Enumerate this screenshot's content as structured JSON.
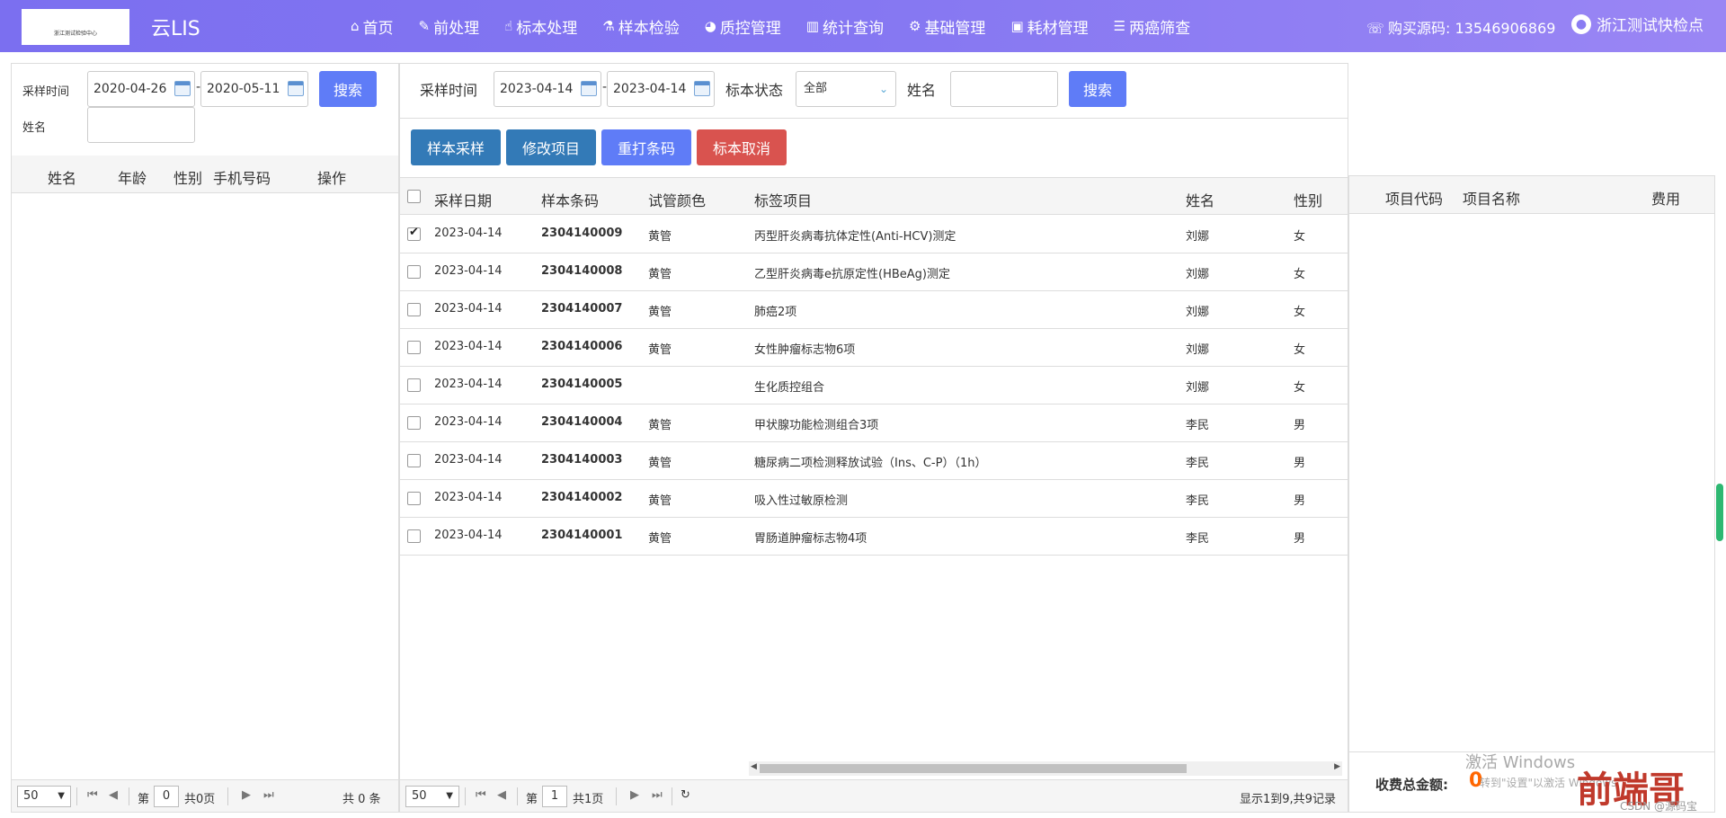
{
  "app": {
    "logo_text": "浙江测试检验中心",
    "brand": "云LIS"
  },
  "nav": [
    {
      "label": "首页",
      "icon": "home-icon",
      "glyph": "⌂"
    },
    {
      "label": "前处理",
      "icon": "wrench-icon",
      "glyph": "✎"
    },
    {
      "label": "标本处理",
      "icon": "hand-icon",
      "glyph": "☝"
    },
    {
      "label": "样本检验",
      "icon": "flask-icon",
      "glyph": "⚗"
    },
    {
      "label": "质控管理",
      "icon": "pie-chart-icon",
      "glyph": "◕"
    },
    {
      "label": "统计查询",
      "icon": "bar-chart-icon",
      "glyph": "▥"
    },
    {
      "label": "基础管理",
      "icon": "gear-icon",
      "glyph": "⚙"
    },
    {
      "label": "耗材管理",
      "icon": "briefcase-icon",
      "glyph": "▣"
    },
    {
      "label": "两癌筛查",
      "icon": "list-icon",
      "glyph": "☰"
    }
  ],
  "header_right": {
    "buy_label": "购买源码: 13546906869",
    "user_name": "浙江测试快检点"
  },
  "left_panel": {
    "sample_time_label": "采样时间",
    "date_from": "2020-04-26",
    "date_to": "2020-05-11",
    "dash": "-",
    "search_button": "搜索",
    "name_label": "姓名",
    "name_value": "",
    "columns": [
      "姓名",
      "年龄",
      "性别",
      "手机号码",
      "操作"
    ],
    "pager": {
      "page_size": "50",
      "page_prefix": "第",
      "page_value": "0",
      "total_pages": "共0页",
      "total_records": "共 0 条"
    }
  },
  "mid_panel": {
    "filters": {
      "sample_time_label": "采样时间",
      "date_from": "2023-04-14",
      "date_to": "2023-04-14",
      "dash": "-",
      "status_label": "标本状态",
      "status_value": "全部",
      "name_label": "姓名",
      "name_value": "",
      "search_button": "搜索"
    },
    "actions": {
      "collect": "样本采样",
      "modify": "修改项目",
      "reprint": "重打条码",
      "cancel": "标本取消"
    },
    "columns": [
      "采样日期",
      "样本条码",
      "试管颜色",
      "标签项目",
      "姓名",
      "性别"
    ],
    "rows": [
      {
        "checked": true,
        "date": "2023-04-14",
        "barcode": "2304140009",
        "tube": "黄管",
        "item": "丙型肝炎病毒抗体定性(Anti-HCV)测定",
        "name": "刘娜",
        "sex": "女"
      },
      {
        "checked": false,
        "date": "2023-04-14",
        "barcode": "2304140008",
        "tube": "黄管",
        "item": "乙型肝炎病毒e抗原定性(HBeAg)测定",
        "name": "刘娜",
        "sex": "女"
      },
      {
        "checked": false,
        "date": "2023-04-14",
        "barcode": "2304140007",
        "tube": "黄管",
        "item": "肺癌2项",
        "name": "刘娜",
        "sex": "女"
      },
      {
        "checked": false,
        "date": "2023-04-14",
        "barcode": "2304140006",
        "tube": "黄管",
        "item": "女性肿瘤标志物6项",
        "name": "刘娜",
        "sex": "女"
      },
      {
        "checked": false,
        "date": "2023-04-14",
        "barcode": "2304140005",
        "tube": "",
        "item": "生化质控组合",
        "name": "刘娜",
        "sex": "女"
      },
      {
        "checked": false,
        "date": "2023-04-14",
        "barcode": "2304140004",
        "tube": "黄管",
        "item": "甲状腺功能检测组合3项",
        "name": "李民",
        "sex": "男"
      },
      {
        "checked": false,
        "date": "2023-04-14",
        "barcode": "2304140003",
        "tube": "黄管",
        "item": "糖尿病二项检测释放试验（Ins、C-P）（1h）",
        "name": "李民",
        "sex": "男"
      },
      {
        "checked": false,
        "date": "2023-04-14",
        "barcode": "2304140002",
        "tube": "黄管",
        "item": "吸入性过敏原检测",
        "name": "李民",
        "sex": "男"
      },
      {
        "checked": false,
        "date": "2023-04-14",
        "barcode": "2304140001",
        "tube": "黄管",
        "item": "胃肠道肿瘤标志物4项",
        "name": "李民",
        "sex": "男"
      }
    ],
    "pager": {
      "page_size": "50",
      "page_prefix": "第",
      "page_value": "1",
      "total_pages": "共1页",
      "summary": "显示1到9,共9记录"
    }
  },
  "right_panel": {
    "columns": [
      "项目代码",
      "项目名称",
      "费用"
    ],
    "total_label": "收费总金额:",
    "total_value": "0"
  },
  "watermarks": {
    "activate_title": "激活 Windows",
    "activate_hint": "转到\"设置\"以激活 Windows",
    "brand_mark": "前端哥",
    "csdn": "CSDN @源码宝"
  }
}
